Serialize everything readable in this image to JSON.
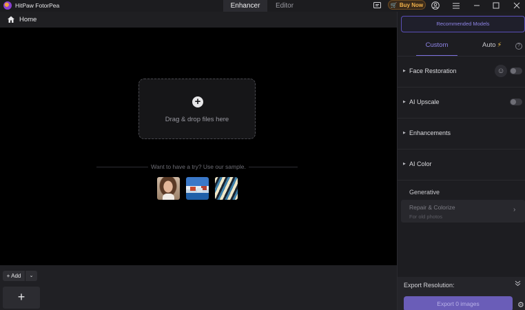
{
  "titlebar": {
    "app_name": "HitPaw FotorPea",
    "tabs": [
      "Enhancer",
      "Editor"
    ],
    "buy_label": "Buy Now",
    "accent_color": "#f2b24a"
  },
  "homebar": {
    "label": "Home"
  },
  "canvas": {
    "drop_text": "Drag & drop files here",
    "sample_text": "Want to have a try? Use our sample.",
    "samples": [
      "sample-portrait",
      "sample-coast",
      "sample-fish"
    ]
  },
  "bottom": {
    "add_label": "Add"
  },
  "panel": {
    "recommended_label": "Recommended Models",
    "tabs": {
      "custom": "Custom",
      "auto": "Auto"
    },
    "sections": [
      {
        "label": "Face Restoration",
        "toggle": false
      },
      {
        "label": "AI Upscale",
        "toggle": false
      },
      {
        "label": "Enhancements"
      },
      {
        "label": "AI Color"
      }
    ],
    "generative_label": "Generative",
    "repair": {
      "title": "Repair & Colorize",
      "subtitle": "For old photos"
    },
    "export_resolution_label": "Export Resolution:",
    "export_button_label": "Export 0 images",
    "accent_color": "#7d72e0"
  }
}
